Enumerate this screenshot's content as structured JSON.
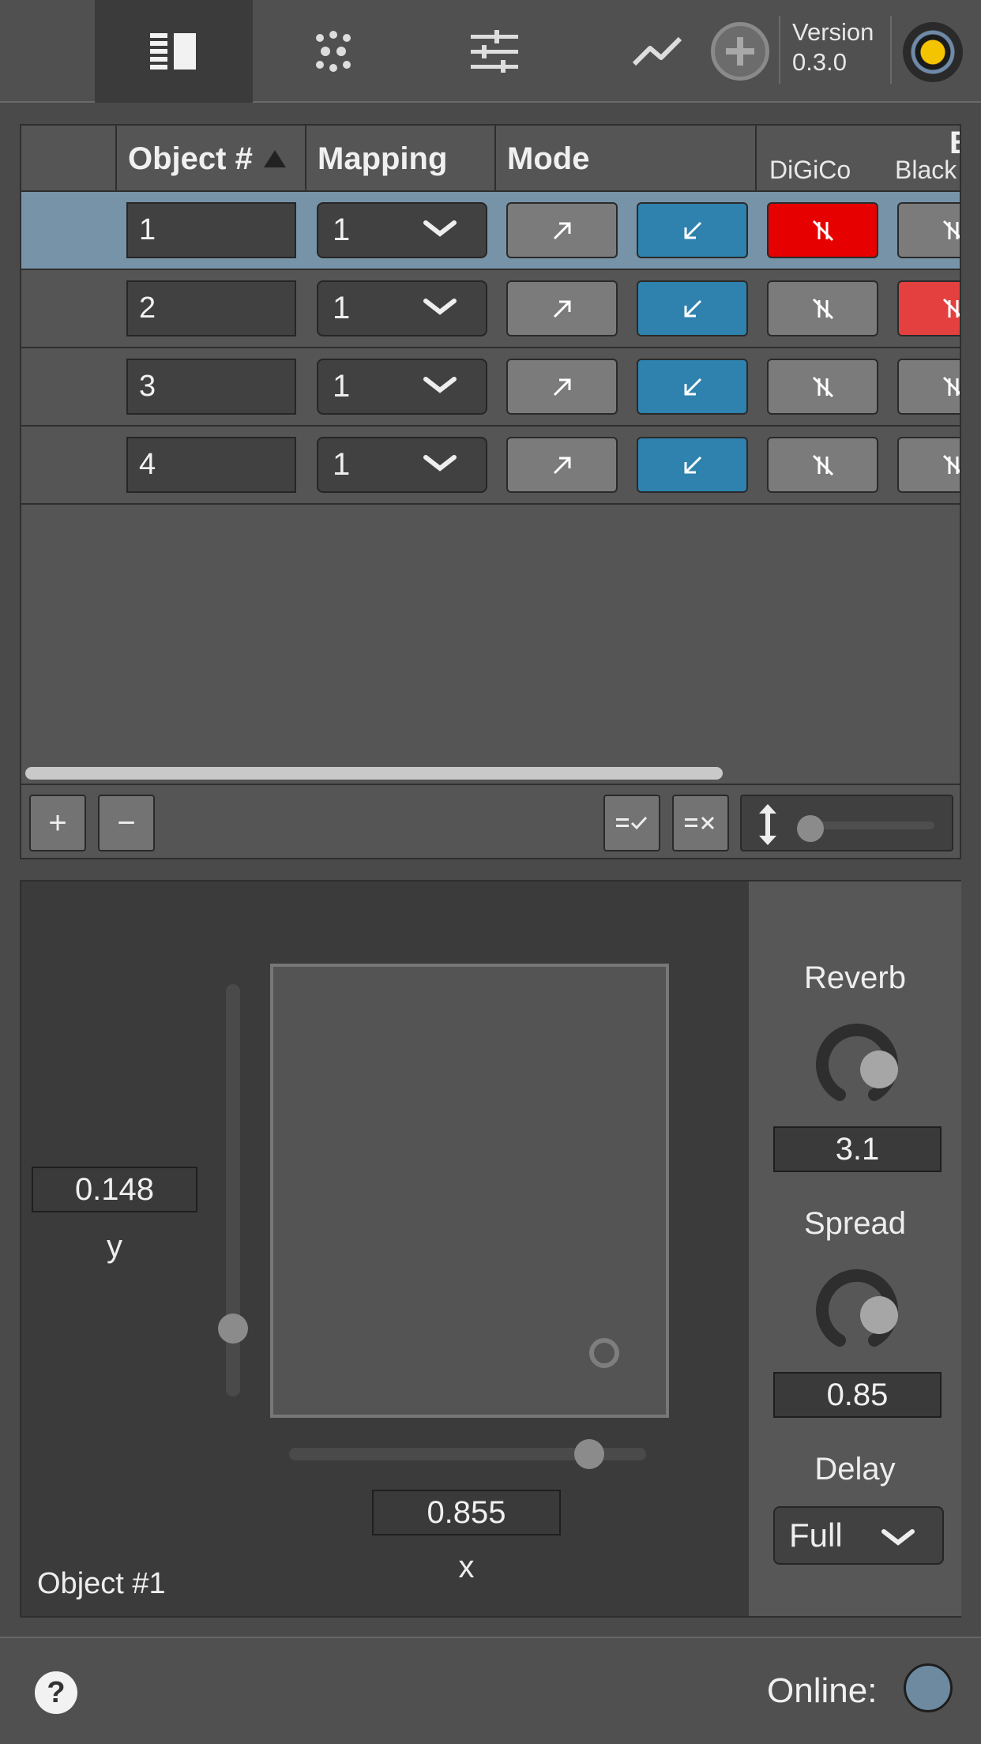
{
  "topbar": {
    "tabs": [
      {
        "icon": "table-view-icon",
        "active": true
      },
      {
        "icon": "multislider-icon",
        "active": false
      },
      {
        "icon": "sliders-icon",
        "active": false
      },
      {
        "icon": "chart-icon",
        "active": false
      }
    ],
    "add_icon": "plus-circle-icon",
    "version_label": "Version",
    "version_number": "0.3.0"
  },
  "table": {
    "columns": {
      "object": "Object #",
      "mapping": "Mapping",
      "mode": "Mode",
      "bridging_partial": "B",
      "digico": "DiGiCo",
      "blacktrax": "Black"
    },
    "rows": [
      {
        "object": "1",
        "mapping": "1",
        "selected": true,
        "digico": "red",
        "blacktrax": "grey"
      },
      {
        "object": "2",
        "mapping": "1",
        "selected": false,
        "digico": "grey",
        "blacktrax": "lightred"
      },
      {
        "object": "3",
        "mapping": "1",
        "selected": false,
        "digico": "grey",
        "blacktrax": "grey"
      },
      {
        "object": "4",
        "mapping": "1",
        "selected": false,
        "digico": "grey",
        "blacktrax": "grey"
      }
    ],
    "footer": {
      "add": "+",
      "remove": "−",
      "select_all_icon": "select-all-icon",
      "select_none_icon": "select-none-icon",
      "row_height_icon": "row-height-icon"
    }
  },
  "editor": {
    "y_value": "0.148",
    "y_label": "y",
    "x_value": "0.855",
    "x_label": "x",
    "object_name": "Object #1",
    "reverb_label": "Reverb",
    "reverb_value": "3.1",
    "spread_label": "Spread",
    "spread_value": "0.85",
    "delay_label": "Delay",
    "delay_value": "Full"
  },
  "status": {
    "help": "?",
    "online_label": "Online:",
    "online_color": "#6d8aa0"
  }
}
